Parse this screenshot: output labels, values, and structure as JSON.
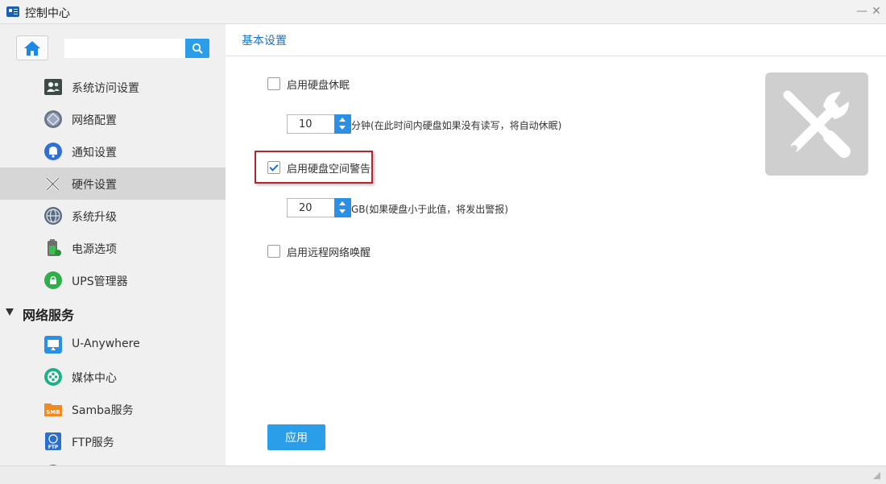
{
  "window": {
    "title": "控制中心"
  },
  "sidebar": {
    "search_placeholder": "",
    "items": [
      {
        "label": "系统访问设置",
        "icon": "user-access-icon"
      },
      {
        "label": "网络配置",
        "icon": "network-globe-icon"
      },
      {
        "label": "通知设置",
        "icon": "bell-icon"
      },
      {
        "label": "硬件设置",
        "icon": "tools-icon",
        "active": true
      },
      {
        "label": "系统升级",
        "icon": "upgrade-globe-icon"
      },
      {
        "label": "电源选项",
        "icon": "battery-icon"
      },
      {
        "label": "UPS管理器",
        "icon": "ups-icon"
      }
    ],
    "section": {
      "label": "网络服务",
      "expanded": true
    },
    "services": [
      {
        "label": "U-Anywhere",
        "icon": "monitor-icon"
      },
      {
        "label": "媒体中心",
        "icon": "film-reel-icon"
      },
      {
        "label": "Samba服务",
        "icon": "samba-folder-icon",
        "icon_text": "SMB"
      },
      {
        "label": "FTP服务",
        "icon": "ftp-icon",
        "icon_text": "FTP"
      }
    ]
  },
  "main": {
    "tab": "基本设置",
    "disk_sleep": {
      "label": "启用硬盘休眠",
      "checked": false,
      "value": "10",
      "hint": "分钟(在此时间内硬盘如果没有读写，将自动休眠)"
    },
    "space_warning": {
      "label": "启用硬盘空间警告",
      "checked": true,
      "value": "20",
      "hint": "GB(如果硬盘小于此值，将发出警报)"
    },
    "wake_on_lan": {
      "label": "启用远程网络唤醒",
      "checked": false
    },
    "apply_label": "应用"
  },
  "colors": {
    "accent": "#2a9ee8",
    "highlight": "#b2262e",
    "sidebar_bg": "#f0f0f0",
    "active_bg": "#d6d6d6"
  }
}
